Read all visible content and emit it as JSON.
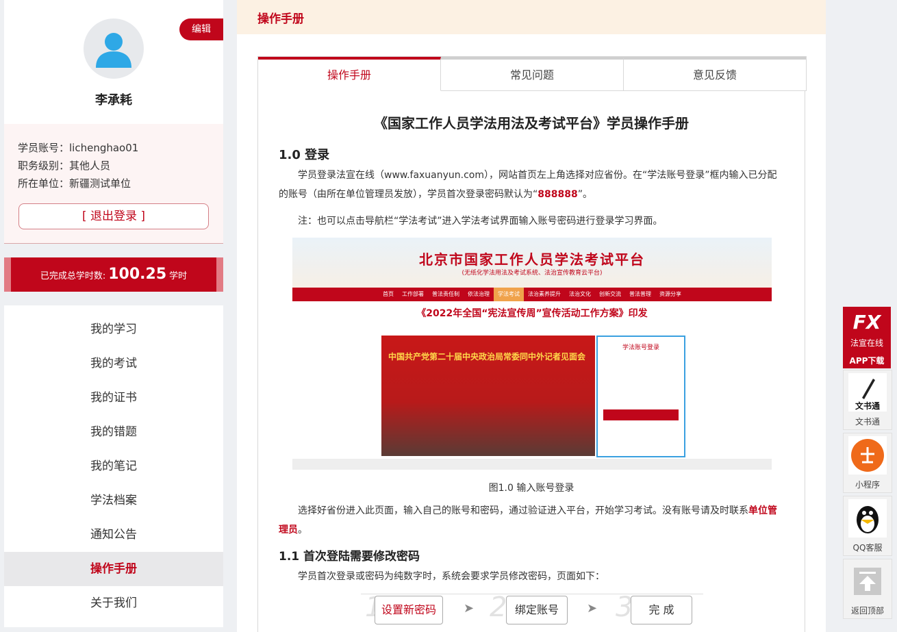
{
  "profile": {
    "edit_label": "编辑",
    "name": "李承耗",
    "account": "学员账号：lichenghao01",
    "rank": "职务级别：其他人员",
    "unit": "所在单位：新疆测试单位",
    "logout_label": "[ 退出登录 ]"
  },
  "hours": {
    "prefix": "已完成总学时数:",
    "value": "100.25",
    "unit": "学时"
  },
  "nav": {
    "items": [
      {
        "label": "我的学习"
      },
      {
        "label": "我的考试"
      },
      {
        "label": "我的证书"
      },
      {
        "label": "我的错题"
      },
      {
        "label": "我的笔记"
      },
      {
        "label": "学法档案"
      },
      {
        "label": "通知公告"
      },
      {
        "label": "操作手册",
        "active": true
      },
      {
        "label": "关于我们"
      }
    ]
  },
  "main": {
    "header": "操作手册",
    "tabs": [
      "操作手册",
      "常见问题",
      "意见反馈"
    ],
    "doc": {
      "title": "《国家工作人员学法用法及考试平台》学员操作手册",
      "sec1_title": "1.0 登录",
      "p1_a": "学员登录法宣在线（www.faxuanyun.com），网站首页左上角选择对应省份。在“学法账号登录”框内输入已分配的账号（由所在单位管理员发放），学员首次登录密码默认为“",
      "p1_pwd": "888888",
      "p1_b": "”。",
      "p2": "注：也可以点击导航栏“学法考试”进入学法考试界面输入账号密码进行登录学习界面。",
      "caption": "图1.0 输入账号登录",
      "p3_a": "选择好省份进入此页面，输入自己的账号和密码，通过验证进入平台，开始学习考试。没有账号请及时联系",
      "p3_link": "单位管理员",
      "p3_b": "。",
      "sec2_title": "1.1 首次登陆需要修改密码",
      "p4": "学员首次登录或密码为纯数字时，系统会要求学员修改密码，页面如下：",
      "steps": [
        {
          "num": "1",
          "label": "设置新密码"
        },
        {
          "num": "2",
          "label": "绑定账号"
        },
        {
          "num": "3",
          "label": "完  成"
        }
      ]
    },
    "shot": {
      "title": "北京市国家工作人员学法考试平台",
      "subtitle": "(无纸化学法用法及考试系统、法治宣传教育云平台)",
      "nav": [
        "首页",
        "工作部署",
        "普法责任制",
        "依法治理",
        "学法考试",
        "法治素养提升",
        "法治文化",
        "创新交流",
        "普法普理",
        "资源分享"
      ],
      "headline": "《2022年全国“宪法宣传周”宣传活动工作方案》印发",
      "photo_title": "中国共产党第二十届中央政治局常委同中外记者见面会",
      "login_title": "学法账号登录"
    }
  },
  "right_toolbar": {
    "app_brand": "法宣在线",
    "app_label": "APP下载",
    "items": [
      {
        "label": "文书通",
        "icon": "pen-icon"
      },
      {
        "label": "小程序",
        "icon": "scale-icon"
      },
      {
        "label": "QQ客服",
        "icon": "penguin-icon"
      },
      {
        "label": "返回顶部",
        "icon": "arrow-up-icon"
      }
    ]
  },
  "colors": {
    "brand": "#c0061b",
    "header_bg": "#fcf1e3"
  }
}
